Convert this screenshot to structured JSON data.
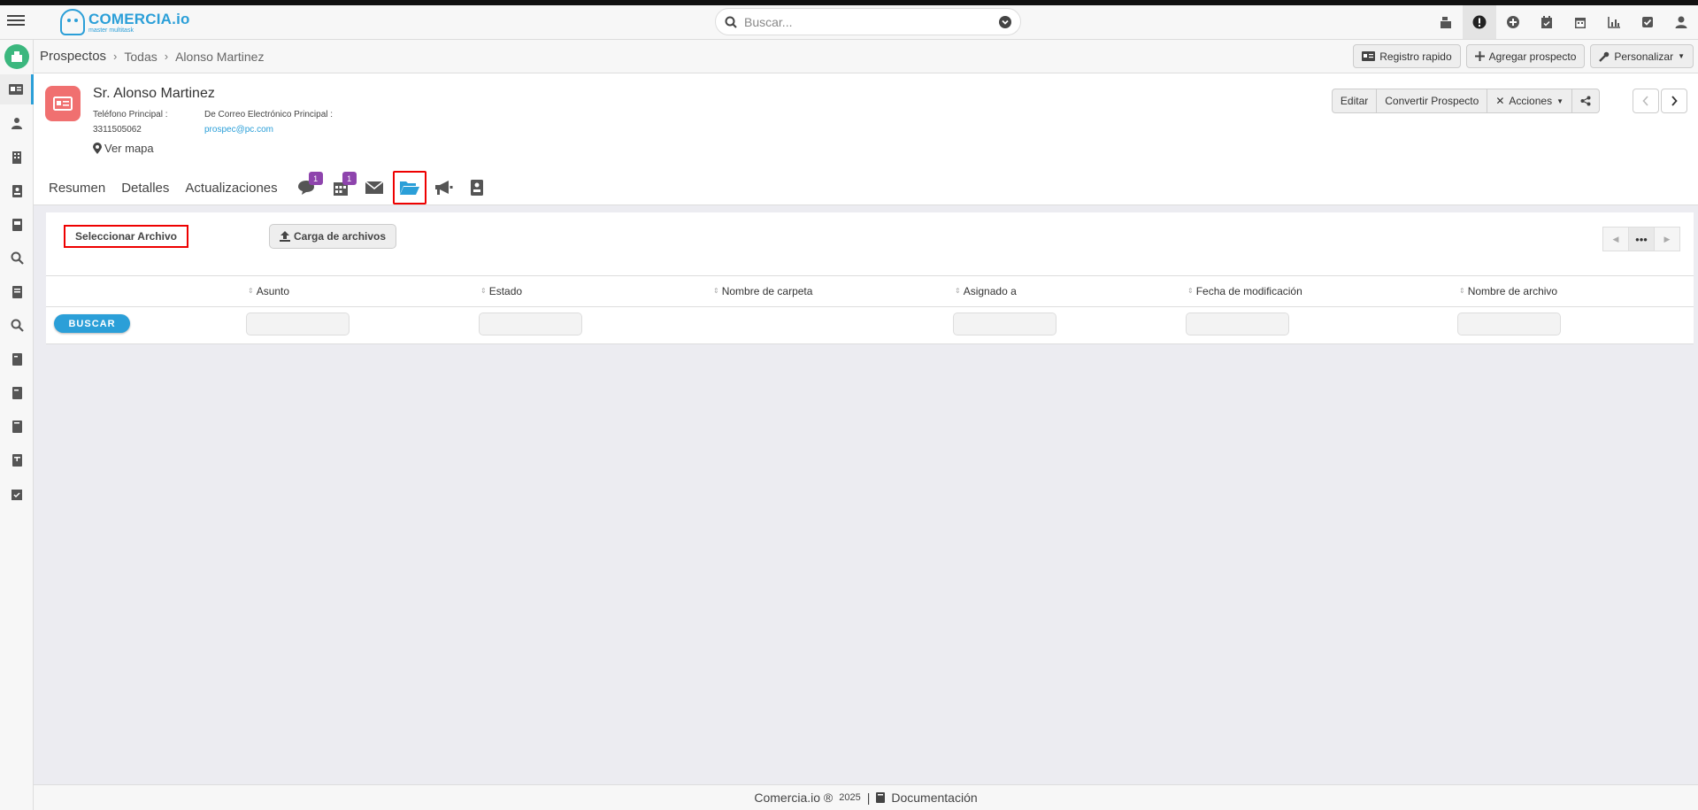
{
  "brand": {
    "name": "COMERCIA.io",
    "tagline": "master multitask"
  },
  "search": {
    "placeholder": "Buscar..."
  },
  "breadcrumb": {
    "root": "Prospectos",
    "middle": "Todas",
    "current": "Alonso Martinez"
  },
  "crumb_actions": {
    "quick": "Registro rapido",
    "add": "Agregar prospecto",
    "customize": "Personalizar"
  },
  "record": {
    "name": "Sr. Alonso Martinez",
    "phone_label": "Teléfono Principal :",
    "phone": "3311505062",
    "email_label": "De Correo Electrónico Principal :",
    "email": "prospec@pc.com",
    "map": "Ver mapa"
  },
  "record_actions": {
    "edit": "Editar",
    "convert": "Convertir Prospecto",
    "actions": "Acciones"
  },
  "tabs": {
    "summary": "Resumen",
    "details": "Detalles",
    "updates": "Actualizaciones",
    "comments_count": "1",
    "events_count": "1"
  },
  "documents": {
    "select_file": "Seleccionar Archivo",
    "upload": "Carga de archivos",
    "pager_more": "•••",
    "columns": [
      "Asunto",
      "Estado",
      "Nombre de carpeta",
      "Asignado a",
      "Fecha de modificación",
      "Nombre de archivo"
    ],
    "search_button": "BUSCAR"
  },
  "footer": {
    "brand": "Comercia.io ®",
    "year": "2025",
    "sep": "|",
    "docs": "Documentación"
  },
  "colors": {
    "accent": "#2b9fd8",
    "badge": "#8e44ad",
    "avatar": "#f07070",
    "highlight": "#ee0000"
  }
}
